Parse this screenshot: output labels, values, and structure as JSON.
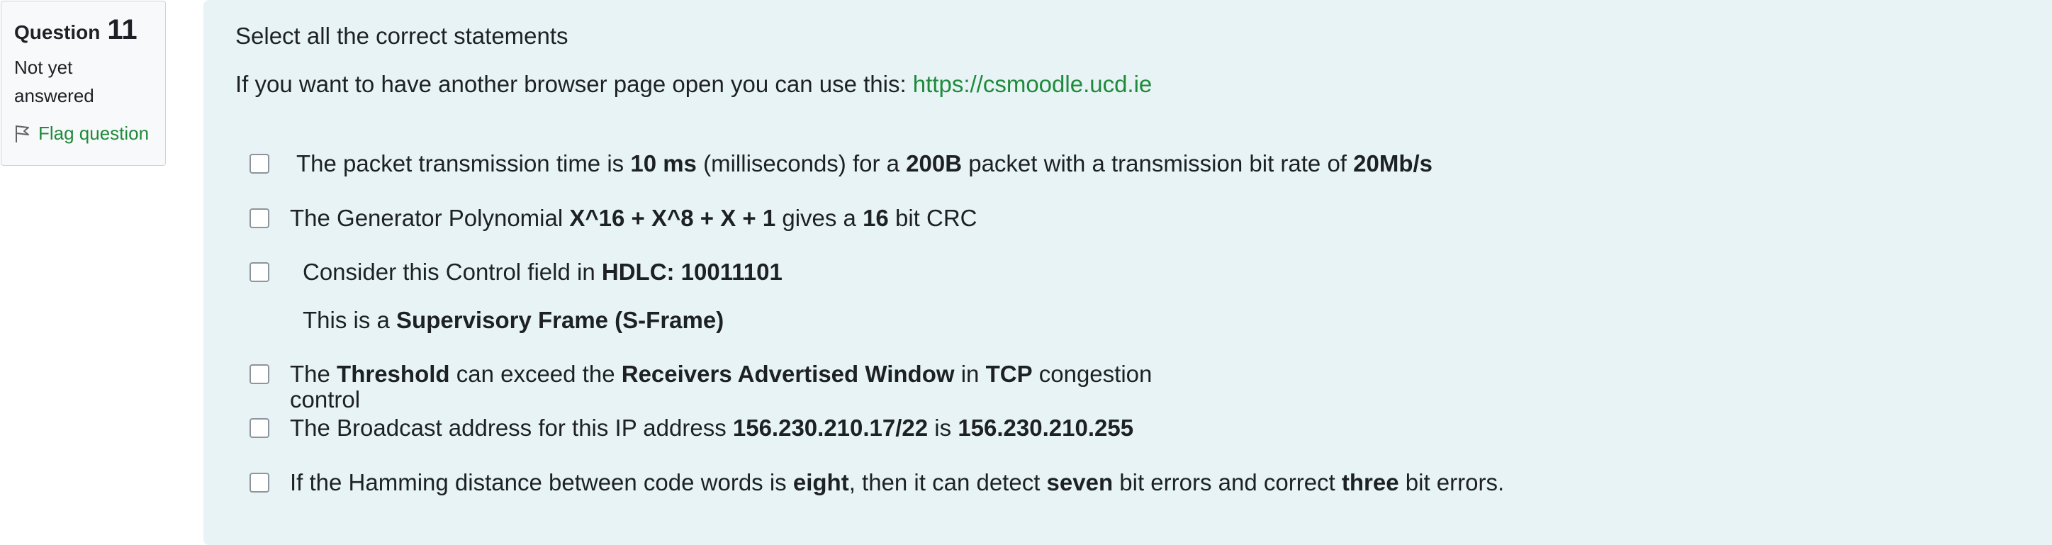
{
  "question_info": {
    "label": "Question",
    "number": "11",
    "state": "Not yet answered",
    "flag_label": "Flag question"
  },
  "intro": {
    "prompt": "Select all the correct statements",
    "browser_text": "If you want to have another browser page open you can use this: ",
    "link": "https://csmoodle.ucd.ie"
  },
  "options": [
    {
      "parts": [
        "The packet transmission time is ",
        "10 ms",
        " (milliseconds) for a ",
        "200B",
        " packet with a transmission bit rate of ",
        "20Mb/s"
      ]
    },
    {
      "parts": [
        "The Generator Polynomial ",
        "X^16 + X^8 + X + 1",
        " gives a ",
        "16",
        " bit CRC"
      ]
    },
    {
      "line1": [
        "Consider this Control field in ",
        "HDLC: 10011101"
      ],
      "line2": [
        "This is a ",
        "Supervisory Frame (S-Frame)"
      ]
    },
    {
      "parts": [
        "The ",
        "Threshold",
        " can exceed the ",
        "Receivers Advertised Window",
        " in ",
        "TCP",
        " congestion"
      ],
      "continuation": "control"
    },
    {
      "parts": [
        "The Broadcast address for this IP address ",
        "156.230.210.17/22",
        " is ",
        "156.230.210.255"
      ]
    },
    {
      "parts": [
        "If the Hamming distance between code words is ",
        "eight",
        ", then it can detect ",
        "seven",
        " bit errors and correct ",
        "three",
        " bit errors."
      ]
    }
  ]
}
